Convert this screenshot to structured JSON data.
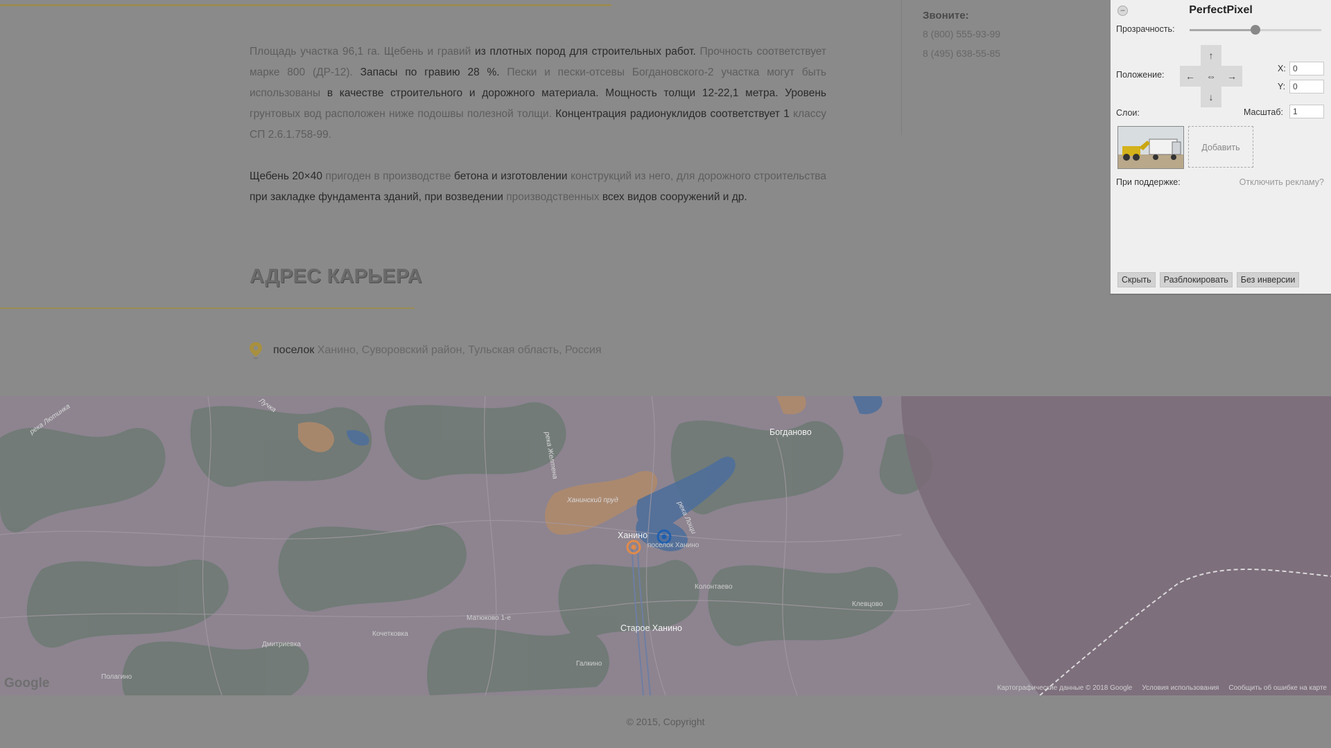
{
  "article": {
    "p1_parts": [
      "Площадь участка 96,1 га. Щебень и гравий ",
      "из плотных пород для строительных работ.",
      " Прочность соответствует марке 800 (ДР-12). ",
      "Запасы по гравию 28 %.",
      " Пески и пески-отсевы Богдановского-2 участка могут быть использованы ",
      "в качестве строительного и дорожного материала. Мощность толщи 12-22,1 метра. Уровень",
      " грунтовых вод расположен ниже подошвы полезной толщи. ",
      "Концентрация радионуклидов соответствует 1",
      " классу СП 2.6.1.758-99."
    ],
    "p2_parts": [
      "Щебень 20×40",
      " пригоден в производстве ",
      "бетона и изготовлении",
      " конструкций из него, для дорожного строительства ",
      "при закладке фундамента зданий, при возведении",
      " производственных ",
      "всех видов сооружений и др."
    ]
  },
  "contacts": {
    "label": "Звоните:",
    "phones": [
      "8 (800) 555-93-99",
      "8 (495) 638-55-85"
    ]
  },
  "address": {
    "heading": "АДРЕС КАРЬЕРА",
    "prefix": "поселок ",
    "rest": "Ханино, Суворовский район, Тульская область, Россия"
  },
  "map": {
    "places": [
      {
        "name": "Богданово",
        "cls": ""
      },
      {
        "name": "Ханино",
        "cls": ""
      },
      {
        "name": "поселок Ханино",
        "cls": ""
      },
      {
        "name": "Колонтаево",
        "cls": "small"
      },
      {
        "name": "Клевцово",
        "cls": "small"
      },
      {
        "name": "Матюково 1-е",
        "cls": "small"
      },
      {
        "name": "Кочетковка",
        "cls": "small"
      },
      {
        "name": "Дмитриевка",
        "cls": "small"
      },
      {
        "name": "Старое Ханино",
        "cls": ""
      },
      {
        "name": "Галкино",
        "cls": "small"
      },
      {
        "name": "Полагино",
        "cls": "small"
      },
      {
        "name": "Ханинский пруд",
        "cls": "river"
      },
      {
        "name": "река Лютинка",
        "cls": "river"
      },
      {
        "name": "река Желтена",
        "cls": "river"
      },
      {
        "name": "река Лощи",
        "cls": "river"
      },
      {
        "name": "Лучка",
        "cls": "river"
      }
    ],
    "google": "Google",
    "footer": [
      "Картографические данные © 2018 Google",
      "Условия использования",
      "Сообщить об ошибке на карте"
    ]
  },
  "copyright": "© 2015, Copyright",
  "pp": {
    "title": "PerfectPixel",
    "collapse": "–",
    "opacity_label": "Прозрачность:",
    "opacity": 0.5,
    "position_label": "Положение:",
    "x_label": "X:",
    "y_label": "Y:",
    "x_value": "0",
    "y_value": "0",
    "layers_label": "Слои:",
    "scale_label": "Масштаб:",
    "scale_value": "1",
    "add_label": "Добавить",
    "support_label": "При поддержке:",
    "ads_link": "Отключить рекламу?",
    "btn_hide": "Скрыть",
    "btn_unlock": "Разблокировать",
    "btn_noinvert": "Без инверсии",
    "arrow_up": "↑",
    "arrow_down": "↓",
    "arrow_left": "←",
    "arrow_right": "→",
    "arrow_center": "⇔"
  },
  "colors": {
    "accent_rule": "#9a8b52",
    "pin": "#a8903e",
    "map_marker_blue": "#1f5fb0",
    "map_marker_orange": "#e08a4a"
  }
}
